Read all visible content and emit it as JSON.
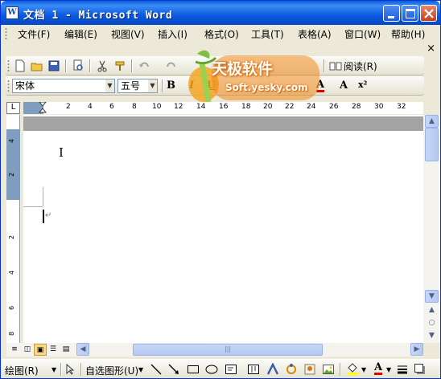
{
  "app": {
    "icon_letter": "W",
    "title": "文档 1 - Microsoft Word"
  },
  "menu": {
    "items": [
      "文件(F)",
      "编辑(E)",
      "视图(V)",
      "插入(I)",
      "格式(O)",
      "工具(T)",
      "表格(A)",
      "窗口(W)",
      "帮助(H)"
    ],
    "close_glyph": "×"
  },
  "standard_toolbar": {
    "read_label": "阅读(R)"
  },
  "format_toolbar": {
    "font_name": "宋体",
    "font_size": "五号",
    "bold": "B",
    "italic": "I",
    "underline": "U",
    "font_color": "A",
    "grow_font": "A",
    "superscript": "x²"
  },
  "ruler": {
    "corner": "L",
    "numbers": [
      "2",
      "4",
      "6",
      "8",
      "10",
      "12",
      "14",
      "16",
      "18",
      "20",
      "22",
      "24",
      "26",
      "28",
      "30",
      "32"
    ],
    "vertical_numbers": [
      "4",
      "2",
      "2",
      "4",
      "6",
      "8"
    ]
  },
  "document": {
    "paragraph_mark": "↵",
    "ibeam": "I"
  },
  "scrollbar": {
    "up": "▲",
    "down": "▼",
    "prev_page": "▲",
    "select_browse": "○",
    "next_page": "▼",
    "left": "◀",
    "right": "▶",
    "grip": "|||"
  },
  "drawing_toolbar": {
    "draw_label": "绘图(R)",
    "autoshape_label": "自选图形(U)"
  },
  "watermark": {
    "title": "天极软件",
    "url": "Soft.yesky.com"
  },
  "colors": {
    "title_bar": "#0b5ae0",
    "chrome": "#ece9d8",
    "font_color_red": "#e00000",
    "highlight_yellow": "#ffff00",
    "watermark_orange": "#e86d0a"
  }
}
